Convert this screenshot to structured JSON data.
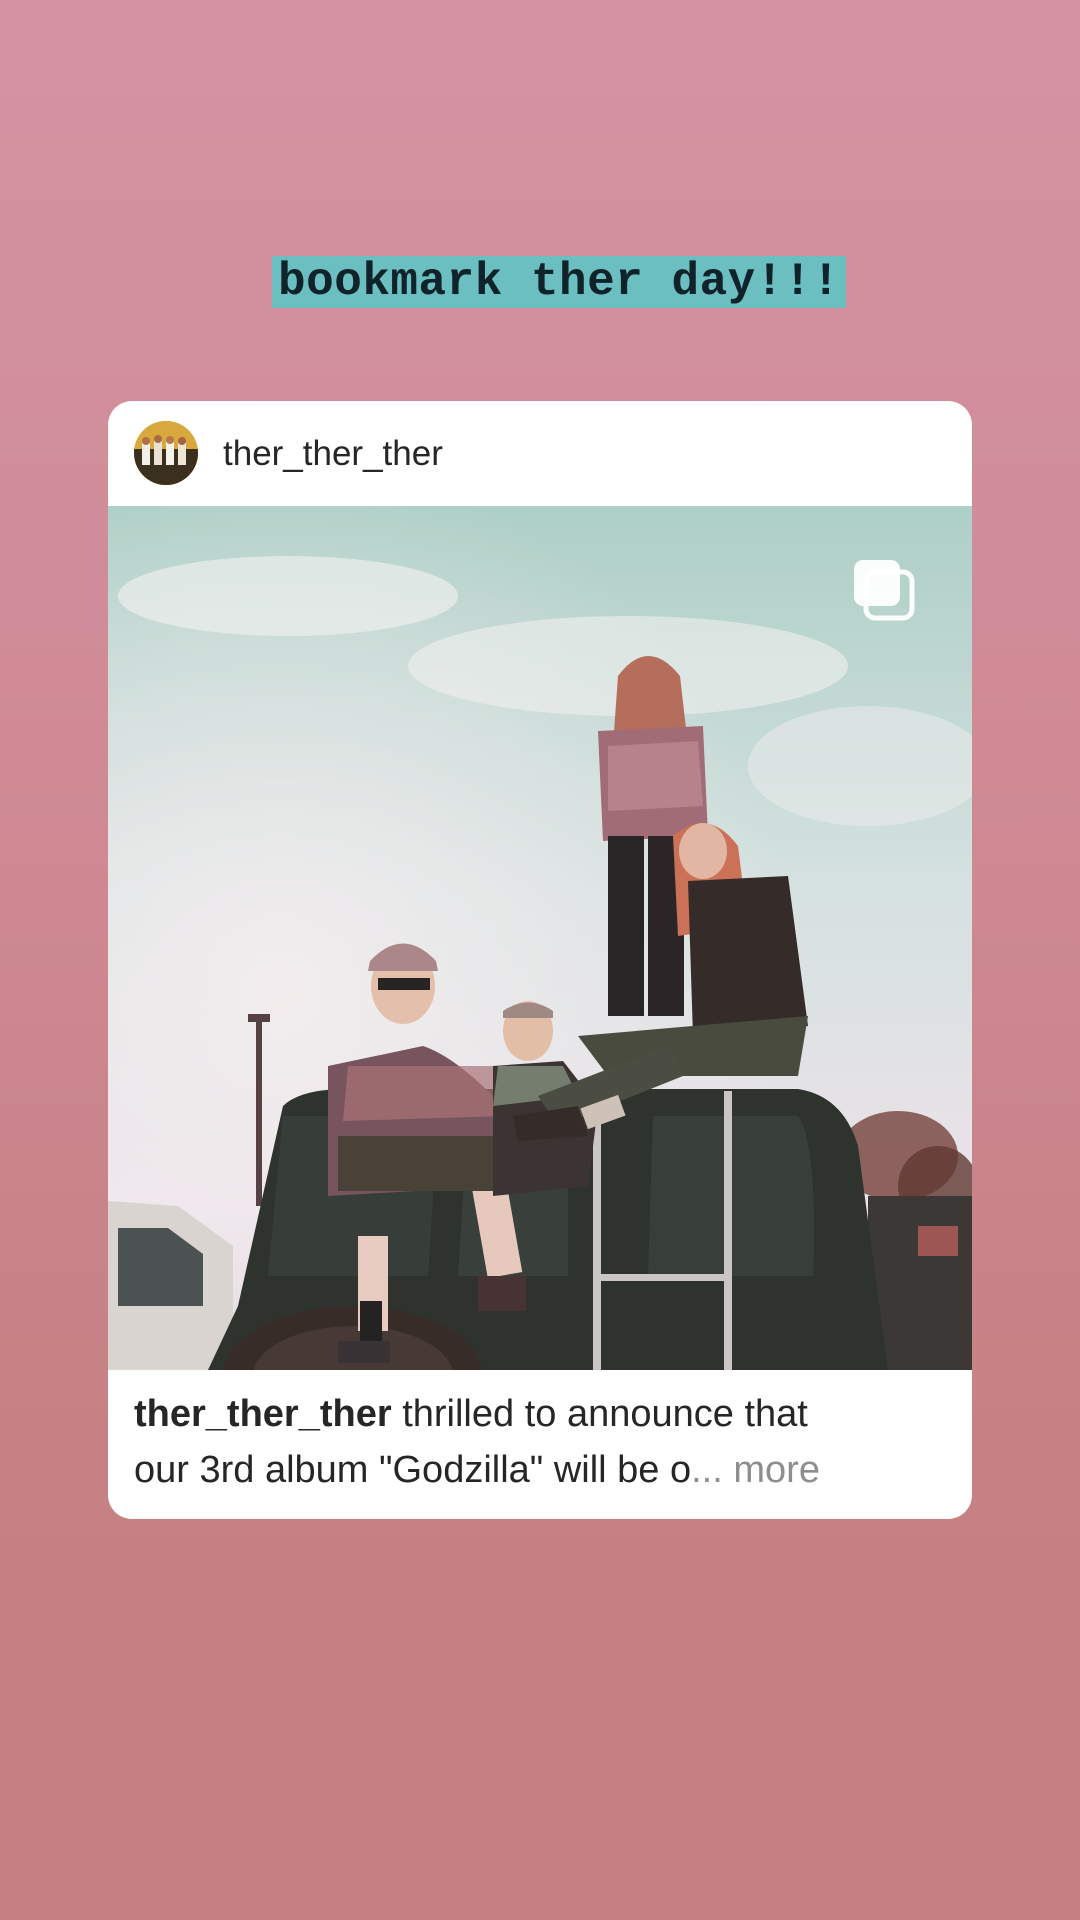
{
  "story": {
    "sticker_text": "bookmark ther day!!!"
  },
  "post": {
    "username": "ther_ther_ther",
    "carousel_icon": "carousel-multiple-icon",
    "caption": {
      "username": "ther_ther_ther",
      "line1": " thrilled to announce that",
      "line2": "our 3rd album \"Godzilla\" will be o",
      "ellipsis": "...",
      "more_label": " more"
    }
  },
  "colors": {
    "background_top": "#d493a3",
    "background_bottom": "#c47f80",
    "sticker_bg": "#6bbfc0",
    "sticker_text": "#10232b",
    "card_bg": "#ffffff",
    "text_primary": "#262626",
    "text_secondary": "#8e8e8e"
  }
}
